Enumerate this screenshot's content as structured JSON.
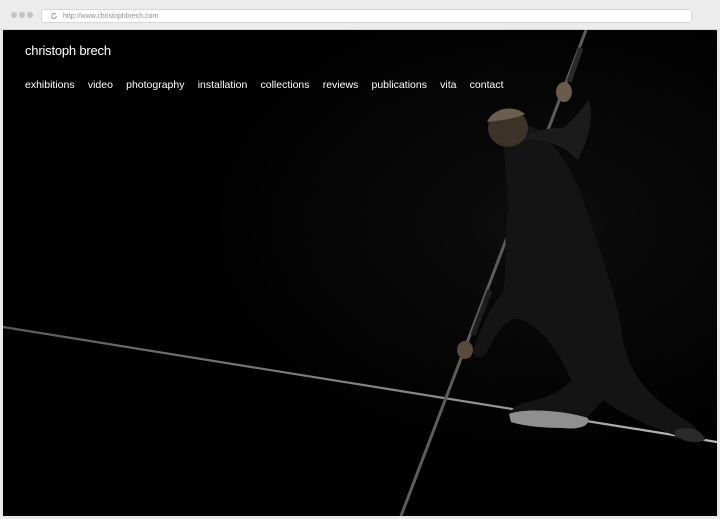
{
  "browser": {
    "url": "http://www.christophbrech.com"
  },
  "site": {
    "title": "christoph brech",
    "nav": [
      {
        "label": "exhibitions"
      },
      {
        "label": "video"
      },
      {
        "label": "photography"
      },
      {
        "label": "installation"
      },
      {
        "label": "collections"
      },
      {
        "label": "reviews"
      },
      {
        "label": "publications"
      },
      {
        "label": "vita"
      },
      {
        "label": "contact"
      }
    ]
  },
  "colors": {
    "background": "#000000",
    "text": "#ffffff",
    "chrome": "#ececec"
  },
  "icons": [
    "reload-icon"
  ]
}
